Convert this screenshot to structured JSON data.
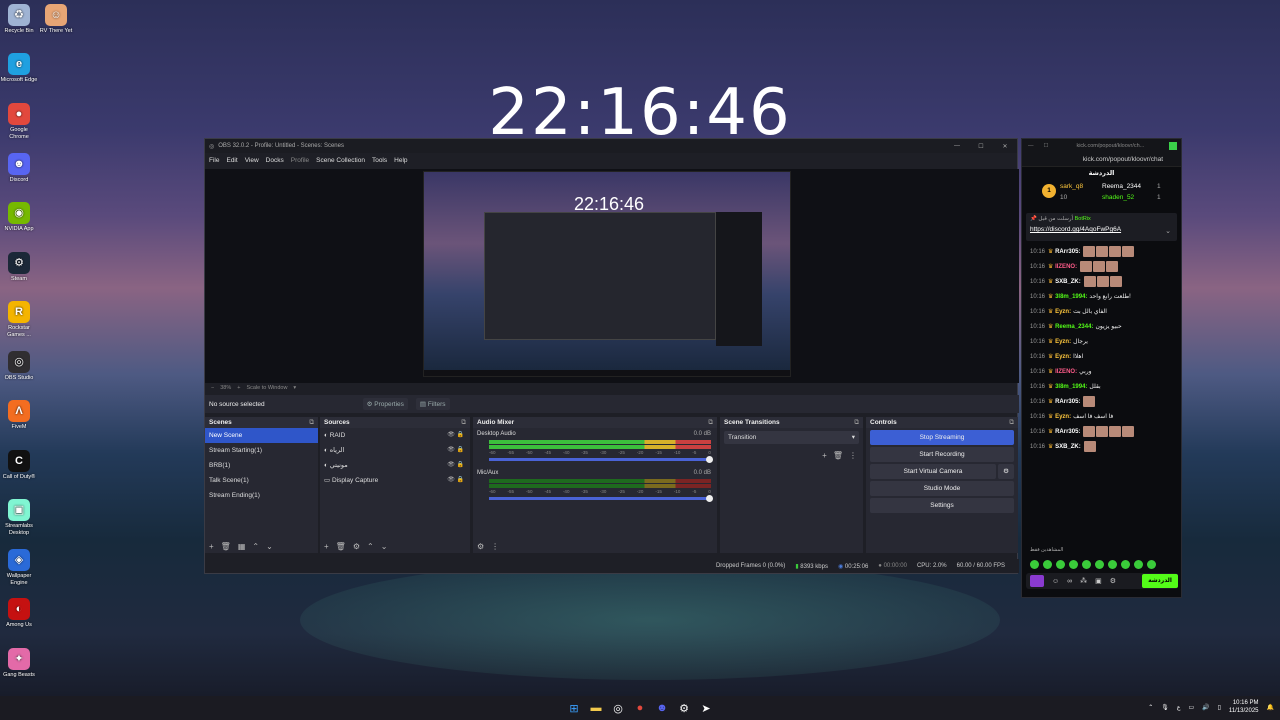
{
  "desktop": {
    "clock": "22:16:46",
    "icons": [
      {
        "label": "Recycle Bin",
        "icon": "recycle-bin-icon",
        "color": "#9fb3d3",
        "glyph": "♻"
      },
      {
        "label": "RV There Yet",
        "icon": "rv-icon",
        "color": "#e7a575",
        "glyph": "☺"
      },
      {
        "label": "Microsoft Edge",
        "icon": "edge-icon",
        "color": "#1fa0e0",
        "glyph": "e"
      },
      {
        "label": "Google Chrome",
        "icon": "chrome-icon",
        "color": "#e2483d",
        "glyph": "●"
      },
      {
        "label": "Discord",
        "icon": "discord-icon",
        "color": "#5865f2",
        "glyph": "☻"
      },
      {
        "label": "NVIDIA App",
        "icon": "nvidia-icon",
        "color": "#76b900",
        "glyph": "◉"
      },
      {
        "label": "Steam",
        "icon": "steam-icon",
        "color": "#1b2838",
        "glyph": "⚙"
      },
      {
        "label": "Rockstar Games ...",
        "icon": "rockstar-icon",
        "color": "#f4b400",
        "glyph": "R"
      },
      {
        "label": "OBS Studio",
        "icon": "obs-icon",
        "color": "#302e31",
        "glyph": "◎"
      },
      {
        "label": "FiveM",
        "icon": "fivem-icon",
        "color": "#f36d21",
        "glyph": "Λ"
      },
      {
        "label": "Call of Duty®",
        "icon": "cod-icon",
        "color": "#111111",
        "glyph": "C"
      },
      {
        "label": "Streamlabs Desktop",
        "icon": "streamlabs-icon",
        "color": "#80f5d2",
        "glyph": "▣"
      },
      {
        "label": "Wallpaper Engine",
        "icon": "wallpaper-engine-icon",
        "color": "#2a6ad8",
        "glyph": "◈"
      },
      {
        "label": "Among Us",
        "icon": "among-us-icon",
        "color": "#c51111",
        "glyph": "◐"
      },
      {
        "label": "Gang Beasts",
        "icon": "gang-beasts-icon",
        "color": "#e36aa8",
        "glyph": "✦"
      }
    ]
  },
  "obs": {
    "title": "OBS 32.0.2 - Profile: Untitled - Scenes: Scenes",
    "menu": [
      "File",
      "Edit",
      "View",
      "Docks",
      "Profile",
      "Scene Collection",
      "Tools",
      "Help"
    ],
    "preview_clock": "22:16:46",
    "zoom": "38%",
    "scale_label": "Scale to Window",
    "no_source": "No source selected",
    "properties_label": "Properties",
    "filters_label": "Filters",
    "scenes_header": "Scenes",
    "scenes": [
      "New Scene",
      "Stream Starting(1)",
      "BRB(1)",
      "Talk Scene(1)",
      "Stream Ending(1)"
    ],
    "sources_header": "Sources",
    "sources": [
      "RAID",
      "الرياه",
      "مونيتي",
      "Display Capture"
    ],
    "mixer_header": "Audio Mixer",
    "mixer": [
      {
        "name": "Desktop Audio",
        "db": "0.0 dB"
      },
      {
        "name": "Mic/Aux",
        "db": "0.0 dB"
      }
    ],
    "meter_ticks": [
      "-60",
      "-55",
      "-50",
      "-45",
      "-40",
      "-35",
      "-30",
      "-25",
      "-20",
      "-15",
      "-10",
      "-5",
      "0"
    ],
    "transitions_header": "Scene Transitions",
    "transition_value": "Transition",
    "controls_header": "Controls",
    "controls": [
      "Stop Streaming",
      "Start Recording",
      "Start Virtual Camera",
      "Studio Mode",
      "Settings"
    ],
    "status": {
      "dropped": "Dropped Frames 0 (0.0%)",
      "bitrate": "8393 kbps",
      "stream_time": "00:25:06",
      "rec_time": "00:00:00",
      "cpu": "CPU: 2.0%",
      "fps": "60.00 / 60.00 FPS"
    }
  },
  "chat": {
    "title": "kick.com/popout/kloovr/ch...",
    "url": "kick.com/popout/kloovr/chat",
    "header": "الدردشة",
    "leader1": {
      "rank": "1",
      "name": "sark_q8",
      "sub": "10"
    },
    "leader2": {
      "name": "Reema_2344",
      "count": "1"
    },
    "leader3": {
      "name": "shaden_52",
      "count": "1"
    },
    "pinned_user": "BotRix",
    "pinned_prefix": "أرسلت من قبل",
    "pinned_link": "https://discord.gg/4AqoFwPg6A",
    "messages": [
      {
        "time": "10:16",
        "user": "RArr305:",
        "color": "#ffffff",
        "text": "",
        "emotes": 4
      },
      {
        "time": "10:16",
        "user": "IIZENO:",
        "color": "#ff5c8a",
        "text": "",
        "emotes": 3
      },
      {
        "time": "10:16",
        "user": "SXB_ZK:",
        "color": "#ffffff",
        "text": "",
        "emotes": 3
      },
      {
        "time": "10:16",
        "user": "3l8m_1994:",
        "color": "#53fc18",
        "text": "طلعت رابع واحد!",
        "emotes": 0
      },
      {
        "time": "10:16",
        "user": "Eyzn:",
        "color": "#ffc83d",
        "text": "الفاي بالل بت",
        "emotes": 0
      },
      {
        "time": "10:16",
        "user": "Reema_2344:",
        "color": "#53fc18",
        "text": "حبيو يزيون",
        "emotes": 0
      },
      {
        "time": "10:16",
        "user": "Eyzn:",
        "color": "#ffc83d",
        "text": "يرجال",
        "emotes": 0
      },
      {
        "time": "10:16",
        "user": "Eyzn:",
        "color": "#ffc83d",
        "text": "اهلاا",
        "emotes": 0
      },
      {
        "time": "10:16",
        "user": "IIZENO:",
        "color": "#ff5c8a",
        "text": "وربي",
        "emotes": 0
      },
      {
        "time": "10:16",
        "user": "3l8m_1994:",
        "color": "#53fc18",
        "text": "بقلل",
        "emotes": 0
      },
      {
        "time": "10:16",
        "user": "RArr305:",
        "color": "#ffffff",
        "text": "",
        "emotes": 1
      },
      {
        "time": "10:16",
        "user": "Eyzn:",
        "color": "#ffc83d",
        "text": "فا اسف فا اسف",
        "emotes": 0
      },
      {
        "time": "10:16",
        "user": "RArr305:",
        "color": "#ffffff",
        "text": "",
        "emotes": 4
      },
      {
        "time": "10:16",
        "user": "SXB_ZK:",
        "color": "#ffffff",
        "text": "",
        "emotes": 1
      }
    ],
    "send_label": "الدردشة",
    "watching": "المشاهدين فقط"
  },
  "taskbar": {
    "lang": "ع",
    "time": "10:16 PM",
    "date": "11/13/2025"
  }
}
